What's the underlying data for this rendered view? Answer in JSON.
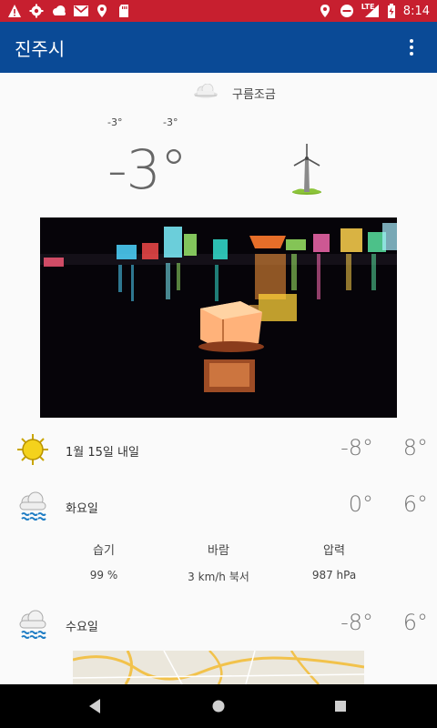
{
  "status_bar": {
    "left_icons": [
      "warning-icon",
      "settings-icon",
      "cloud-icon",
      "gmail-icon",
      "location-icon",
      "sd-card-icon"
    ],
    "right_icons": [
      "location-icon",
      "do-not-disturb-icon",
      "lte-signal-icon",
      "battery-icon"
    ],
    "lte": "LTE",
    "time": "8:14"
  },
  "app_bar": {
    "title": "진주시",
    "menu_icon": "more-vert-icon"
  },
  "current": {
    "condition_icon": "cloud-icon",
    "condition": "구름조금",
    "low": "-3°",
    "high": "-3°",
    "temp": "-3°",
    "wind_icon": "wind-turbine-icon"
  },
  "forecast": [
    {
      "label": "1월 15일 내일",
      "icon": "sun-icon",
      "low": "-8°",
      "high": "8°"
    },
    {
      "label": "화요일",
      "icon": "rain-cloud-icon",
      "low": "0°",
      "high": "6°"
    },
    {
      "label": "수요일",
      "icon": "rain-cloud-icon",
      "low": "-8°",
      "high": "6°"
    }
  ],
  "details": {
    "humidity_label": "습기",
    "humidity": "99 %",
    "wind_label": "바람",
    "wind": "3 km/h 북서",
    "pressure_label": "압력",
    "pressure": "987 hPa"
  },
  "colors": {
    "status_bar": "#c71f2f",
    "app_bar": "#0a4a96",
    "background": "#fafafa"
  },
  "nav_bar": [
    "back-icon",
    "home-icon",
    "recents-icon"
  ]
}
